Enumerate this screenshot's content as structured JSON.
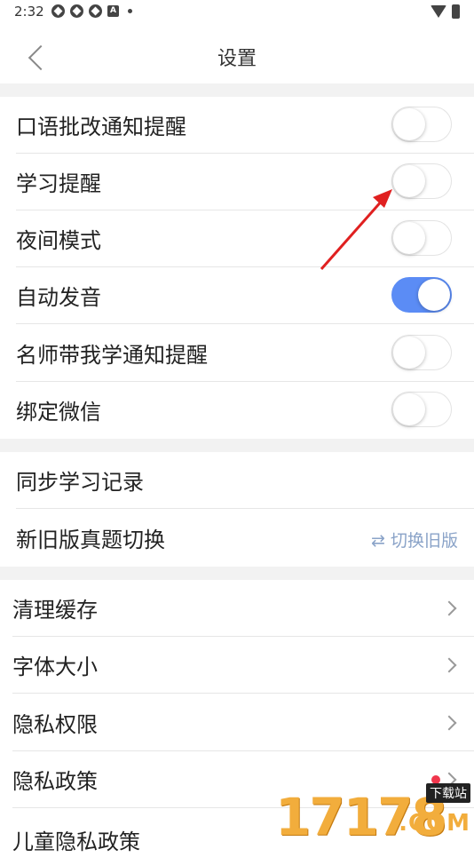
{
  "status_bar": {
    "time": "2:32"
  },
  "header": {
    "title": "设置"
  },
  "toggles": [
    {
      "label": "口语批改通知提醒",
      "on": false
    },
    {
      "label": "学习提醒",
      "on": false
    },
    {
      "label": "夜间模式",
      "on": false
    },
    {
      "label": "自动发音",
      "on": true
    },
    {
      "label": "名师带我学通知提醒",
      "on": false
    },
    {
      "label": "绑定微信",
      "on": false
    }
  ],
  "sync": {
    "label": "同步学习记录"
  },
  "version_switch": {
    "label": "新旧版真题切换",
    "action": "⇄ 切换旧版"
  },
  "menu": [
    {
      "label": "清理缓存"
    },
    {
      "label": "字体大小"
    },
    {
      "label": "隐私权限"
    },
    {
      "label": "隐私政策",
      "has_red_dot": true
    },
    {
      "label": "儿童隐私政策"
    }
  ],
  "annotation": {
    "arrow_color": "#e02020"
  },
  "watermark": {
    "number": "17178",
    "tag": "下载站",
    "suffix": ".COM"
  }
}
